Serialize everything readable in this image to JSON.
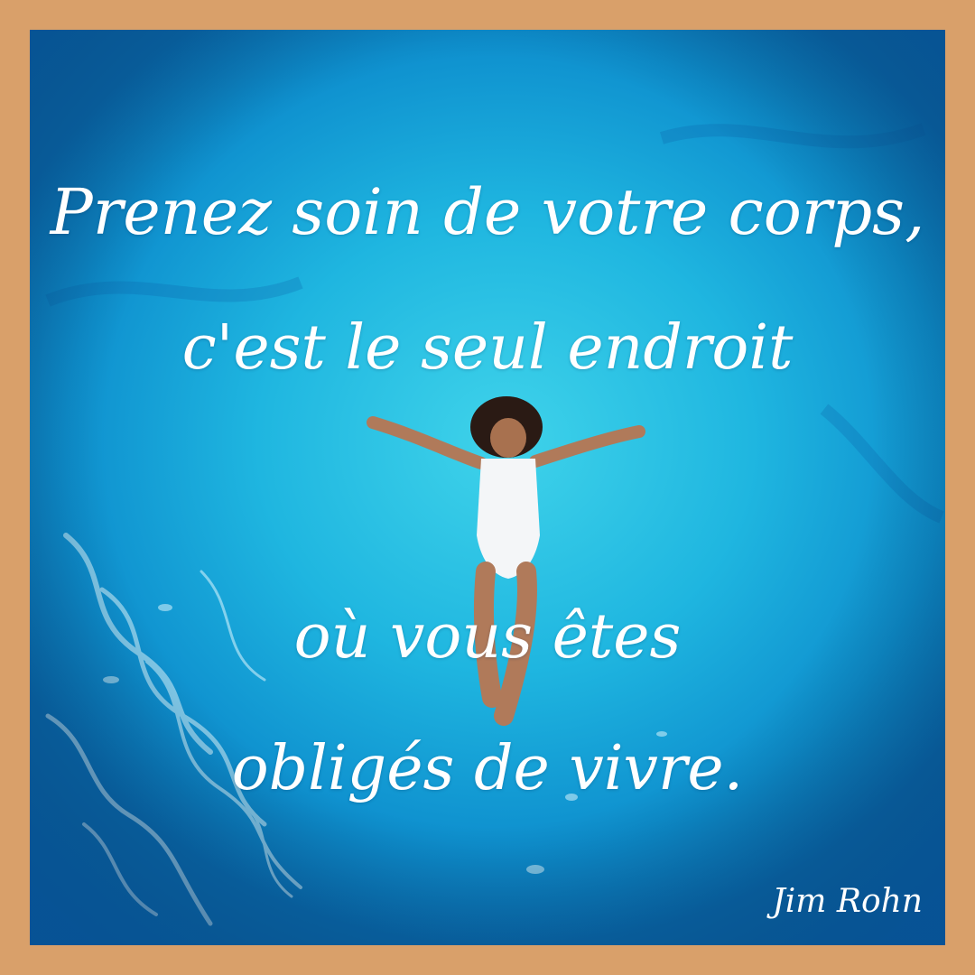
{
  "quote": {
    "line1": "Prenez soin de votre corps,",
    "line2": "c'est le seul endroit",
    "line3": "où vous êtes",
    "line4": "obligés de vivre."
  },
  "author": "Jim Rohn",
  "colors": {
    "border": "#D9A06A",
    "water": "#1FB6E0",
    "text": "#FFFFFF"
  }
}
